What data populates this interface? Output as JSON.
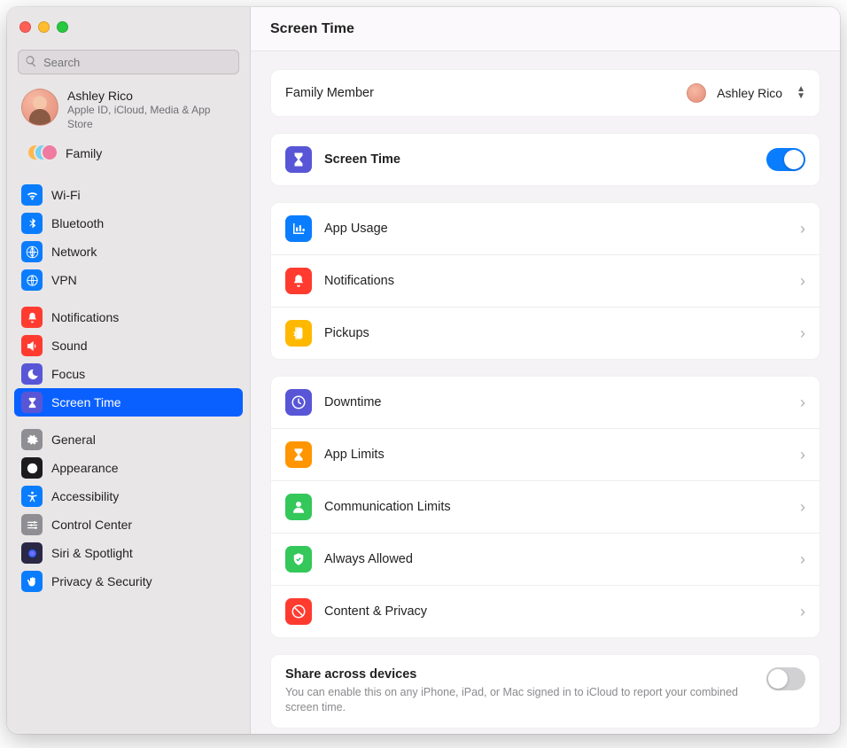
{
  "header": {
    "title": "Screen Time"
  },
  "search": {
    "placeholder": "Search"
  },
  "account": {
    "name": "Ashley Rico",
    "sub": "Apple ID, iCloud, Media & App Store"
  },
  "family": {
    "label": "Family"
  },
  "sidebar": {
    "groups": [
      [
        {
          "label": "Wi-Fi",
          "color": "#0a7dff",
          "icon": "wifi"
        },
        {
          "label": "Bluetooth",
          "color": "#0a7dff",
          "icon": "bluetooth"
        },
        {
          "label": "Network",
          "color": "#0a7dff",
          "icon": "globe"
        },
        {
          "label": "VPN",
          "color": "#0a7dff",
          "icon": "globe-shield"
        }
      ],
      [
        {
          "label": "Notifications",
          "color": "#ff3b30",
          "icon": "bell"
        },
        {
          "label": "Sound",
          "color": "#ff3b30",
          "icon": "speaker"
        },
        {
          "label": "Focus",
          "color": "#5856d6",
          "icon": "moon"
        },
        {
          "label": "Screen Time",
          "color": "#5856d6",
          "icon": "hourglass",
          "selected": true
        }
      ],
      [
        {
          "label": "General",
          "color": "#8e8e93",
          "icon": "gear"
        },
        {
          "label": "Appearance",
          "color": "#1c1c1e",
          "icon": "appearance"
        },
        {
          "label": "Accessibility",
          "color": "#0a7dff",
          "icon": "accessibility"
        },
        {
          "label": "Control Center",
          "color": "#8e8e93",
          "icon": "sliders"
        },
        {
          "label": "Siri & Spotlight",
          "color": "#2b2846",
          "icon": "siri"
        },
        {
          "label": "Privacy & Security",
          "color": "#0a7dff",
          "icon": "hand"
        }
      ]
    ]
  },
  "main": {
    "family_member": {
      "label": "Family Member",
      "value": "Ashley Rico"
    },
    "screen_time_toggle": {
      "label": "Screen Time",
      "on": true,
      "icon_color": "#5856d6"
    },
    "group1": [
      {
        "label": "App Usage",
        "color": "#0a7dff",
        "icon": "chart"
      },
      {
        "label": "Notifications",
        "color": "#ff3b30",
        "icon": "bell"
      },
      {
        "label": "Pickups",
        "color": "#ffb800",
        "icon": "pickup"
      }
    ],
    "group2": [
      {
        "label": "Downtime",
        "color": "#5856d6",
        "icon": "clock"
      },
      {
        "label": "App Limits",
        "color": "#ff9500",
        "icon": "hourglass"
      },
      {
        "label": "Communication Limits",
        "color": "#34c759",
        "icon": "person"
      },
      {
        "label": "Always Allowed",
        "color": "#34c759",
        "icon": "check-shield"
      },
      {
        "label": "Content & Privacy",
        "color": "#ff3b30",
        "icon": "nope"
      }
    ],
    "share": {
      "title": "Share across devices",
      "sub": "You can enable this on any iPhone, iPad, or Mac signed in to iCloud to report your combined screen time.",
      "on": false
    }
  }
}
